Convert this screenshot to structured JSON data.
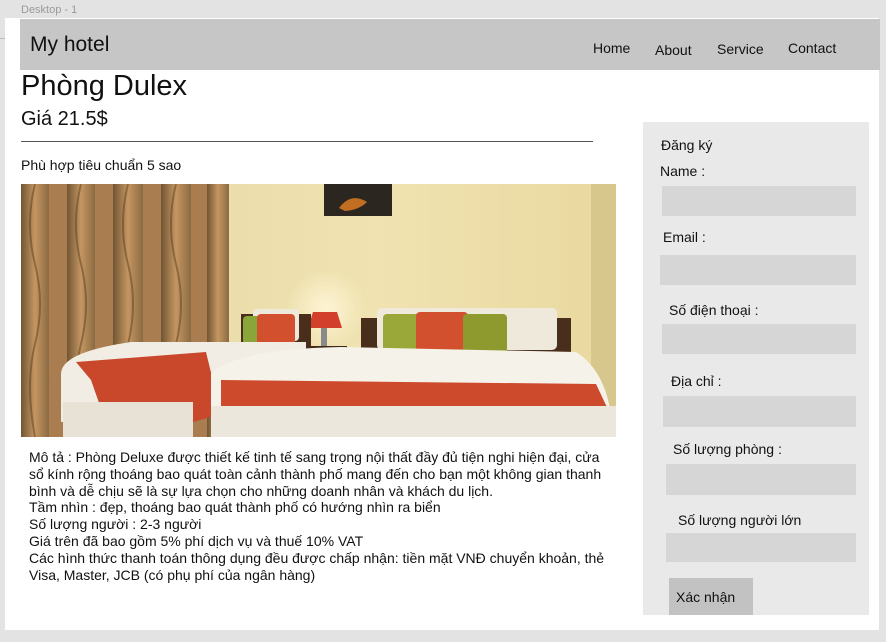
{
  "canvas": {
    "label": "Desktop - 1"
  },
  "nav": {
    "brand": "My hotel",
    "links": [
      "Home",
      "About",
      "Service",
      "Contact"
    ]
  },
  "room": {
    "title": "Phòng Dulex",
    "price": "Giá 21.5$",
    "standard": "Phù hợp tiêu chuẩn 5 sao",
    "description_lines": [
      "Mô tả : Phòng Deluxe được thiết kế tinh tế sang trọng nội thất đầy đủ tiện nghi hiện đại, cửa",
      "sổ kính rộng thoáng bao quát toàn cảnh thành phố mang đến cho bạn một không gian thanh",
      "bình và dễ chịu sẽ là sự lựa chọn cho những doanh nhân và khách du lịch.",
      "Tầm nhìn : đẹp, thoáng bao quát thành phố có hướng nhìn ra biển",
      "Số lượng người : 2-3 người",
      "Giá trên đã bao gồm 5% phí dịch vụ và thuế 10% VAT",
      "Các hình thức thanh toán thông dụng đều được chấp nhận: tiền mặt VNĐ chuyển khoản, thẻ",
      "Visa, Master, JCB (có phụ phí của ngân hàng)"
    ]
  },
  "form": {
    "heading": "Đăng ký",
    "fields": [
      {
        "label": "Name :",
        "value": ""
      },
      {
        "label": "Email :",
        "value": ""
      },
      {
        "label": "Số điện thoại :",
        "value": ""
      },
      {
        "label": "Địa chỉ :",
        "value": ""
      },
      {
        "label": "Số lượng phòng :",
        "value": ""
      },
      {
        "label": "Số lượng người lớn",
        "value": ""
      }
    ],
    "submit_label": "Xác nhận"
  },
  "colors": {
    "navbar": "#c6c6c6",
    "sidebar": "#e9e9e9",
    "input": "#d6d6d6",
    "button": "#c2c2c2",
    "canvas": "#e3e3e3"
  }
}
